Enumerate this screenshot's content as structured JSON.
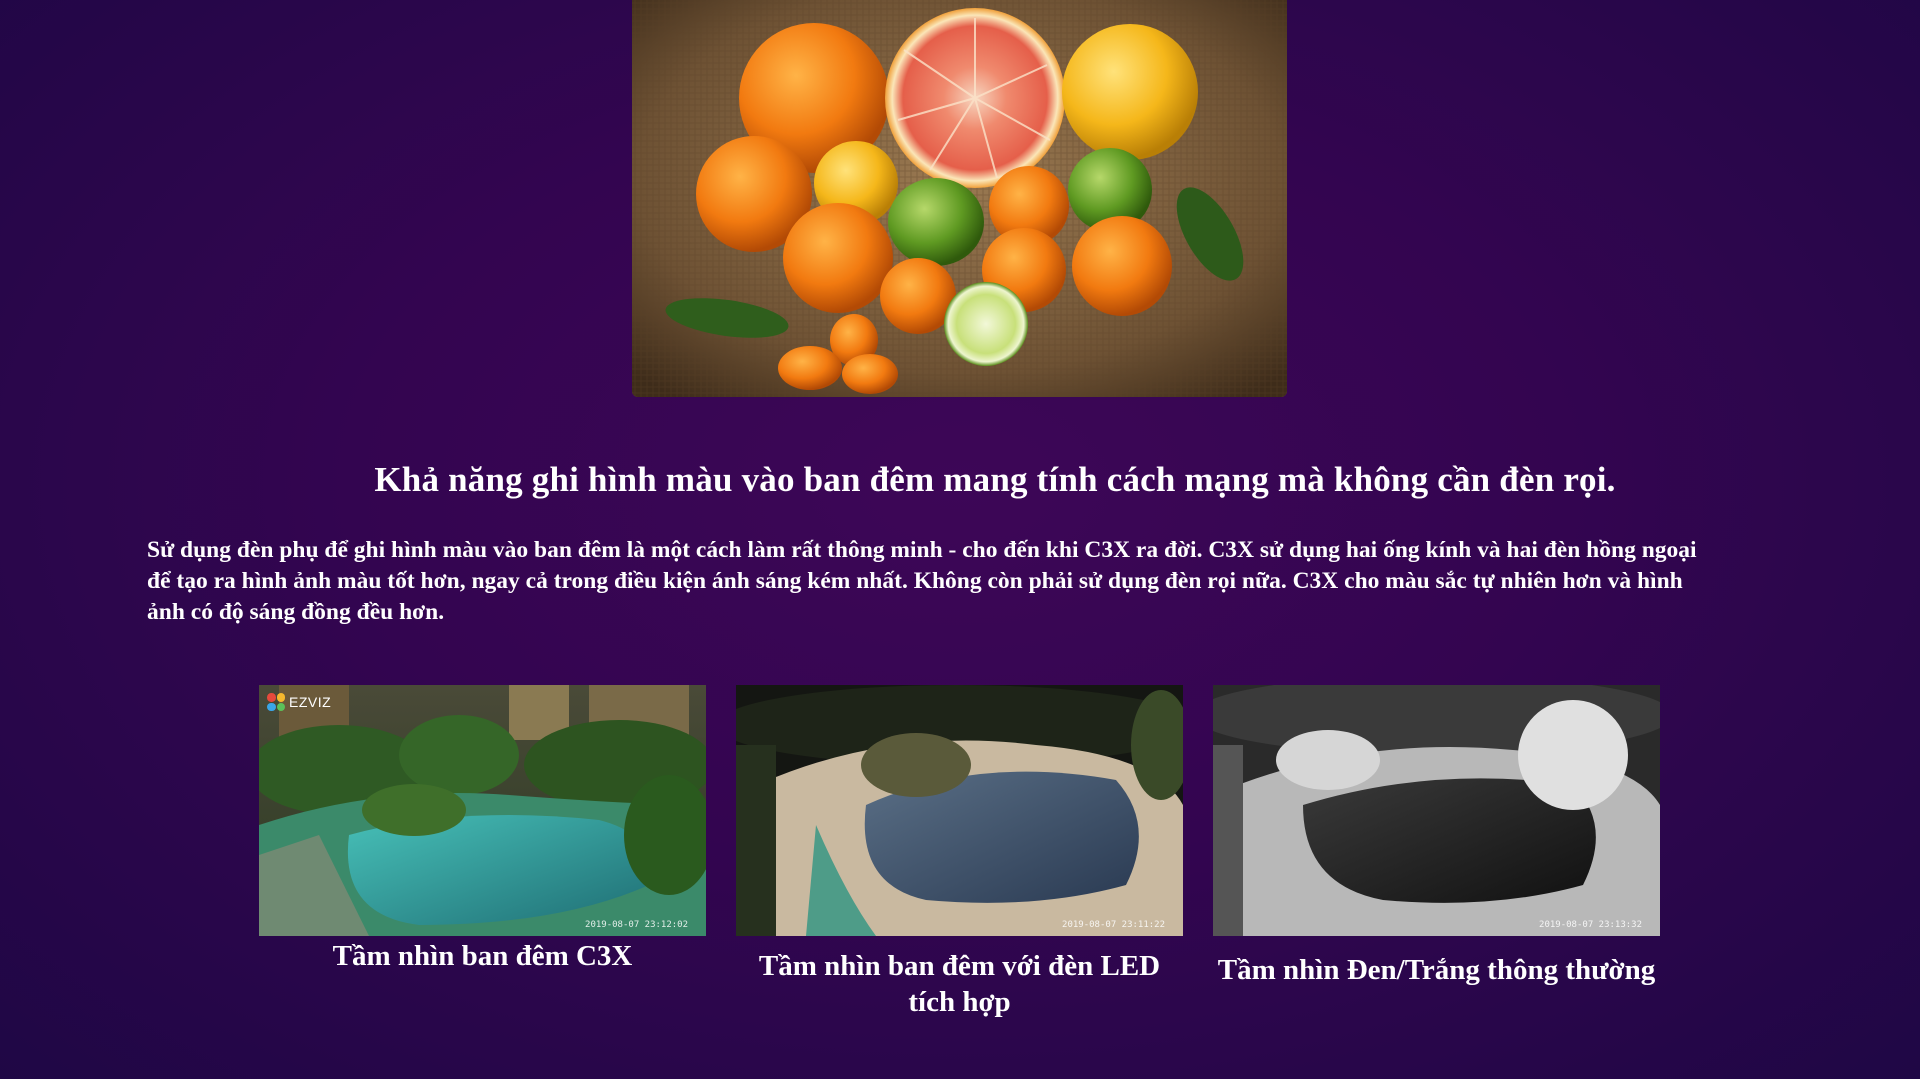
{
  "hero": {
    "image_alt": "citrus fruits on burlap"
  },
  "headline": "Khả năng ghi hình màu vào ban đêm mang tính cách mạng mà không cần đèn rọi.",
  "description": "Sử dụng đèn phụ để ghi hình màu vào ban đêm là một cách làm rất thông minh - cho đến khi C3X ra đời. C3X sử dụng hai ống kính và hai đèn hồng ngoại để tạo ra hình ảnh màu tốt hơn, ngay cả trong điều kiện ánh sáng kém nhất. Không còn phải sử dụng đèn rọi nữa. C3X cho màu sắc tự nhiên hơn và hình ảnh có độ sáng đồng đều hơn.",
  "cameras": [
    {
      "logo_text": "EZVIZ",
      "timestamp": "2019-08-07 23:12:02",
      "caption": "Tầm nhìn ban đêm C3X"
    },
    {
      "timestamp": "2019-08-07 23:11:22",
      "caption": "Tầm nhìn ban đêm với đèn LED tích hợp"
    },
    {
      "timestamp": "2019-08-07 23:13:32",
      "caption": "Tầm nhìn Đen/Trắng thông thường"
    }
  ],
  "colors": {
    "background": "#330550",
    "text": "#ffffff"
  }
}
